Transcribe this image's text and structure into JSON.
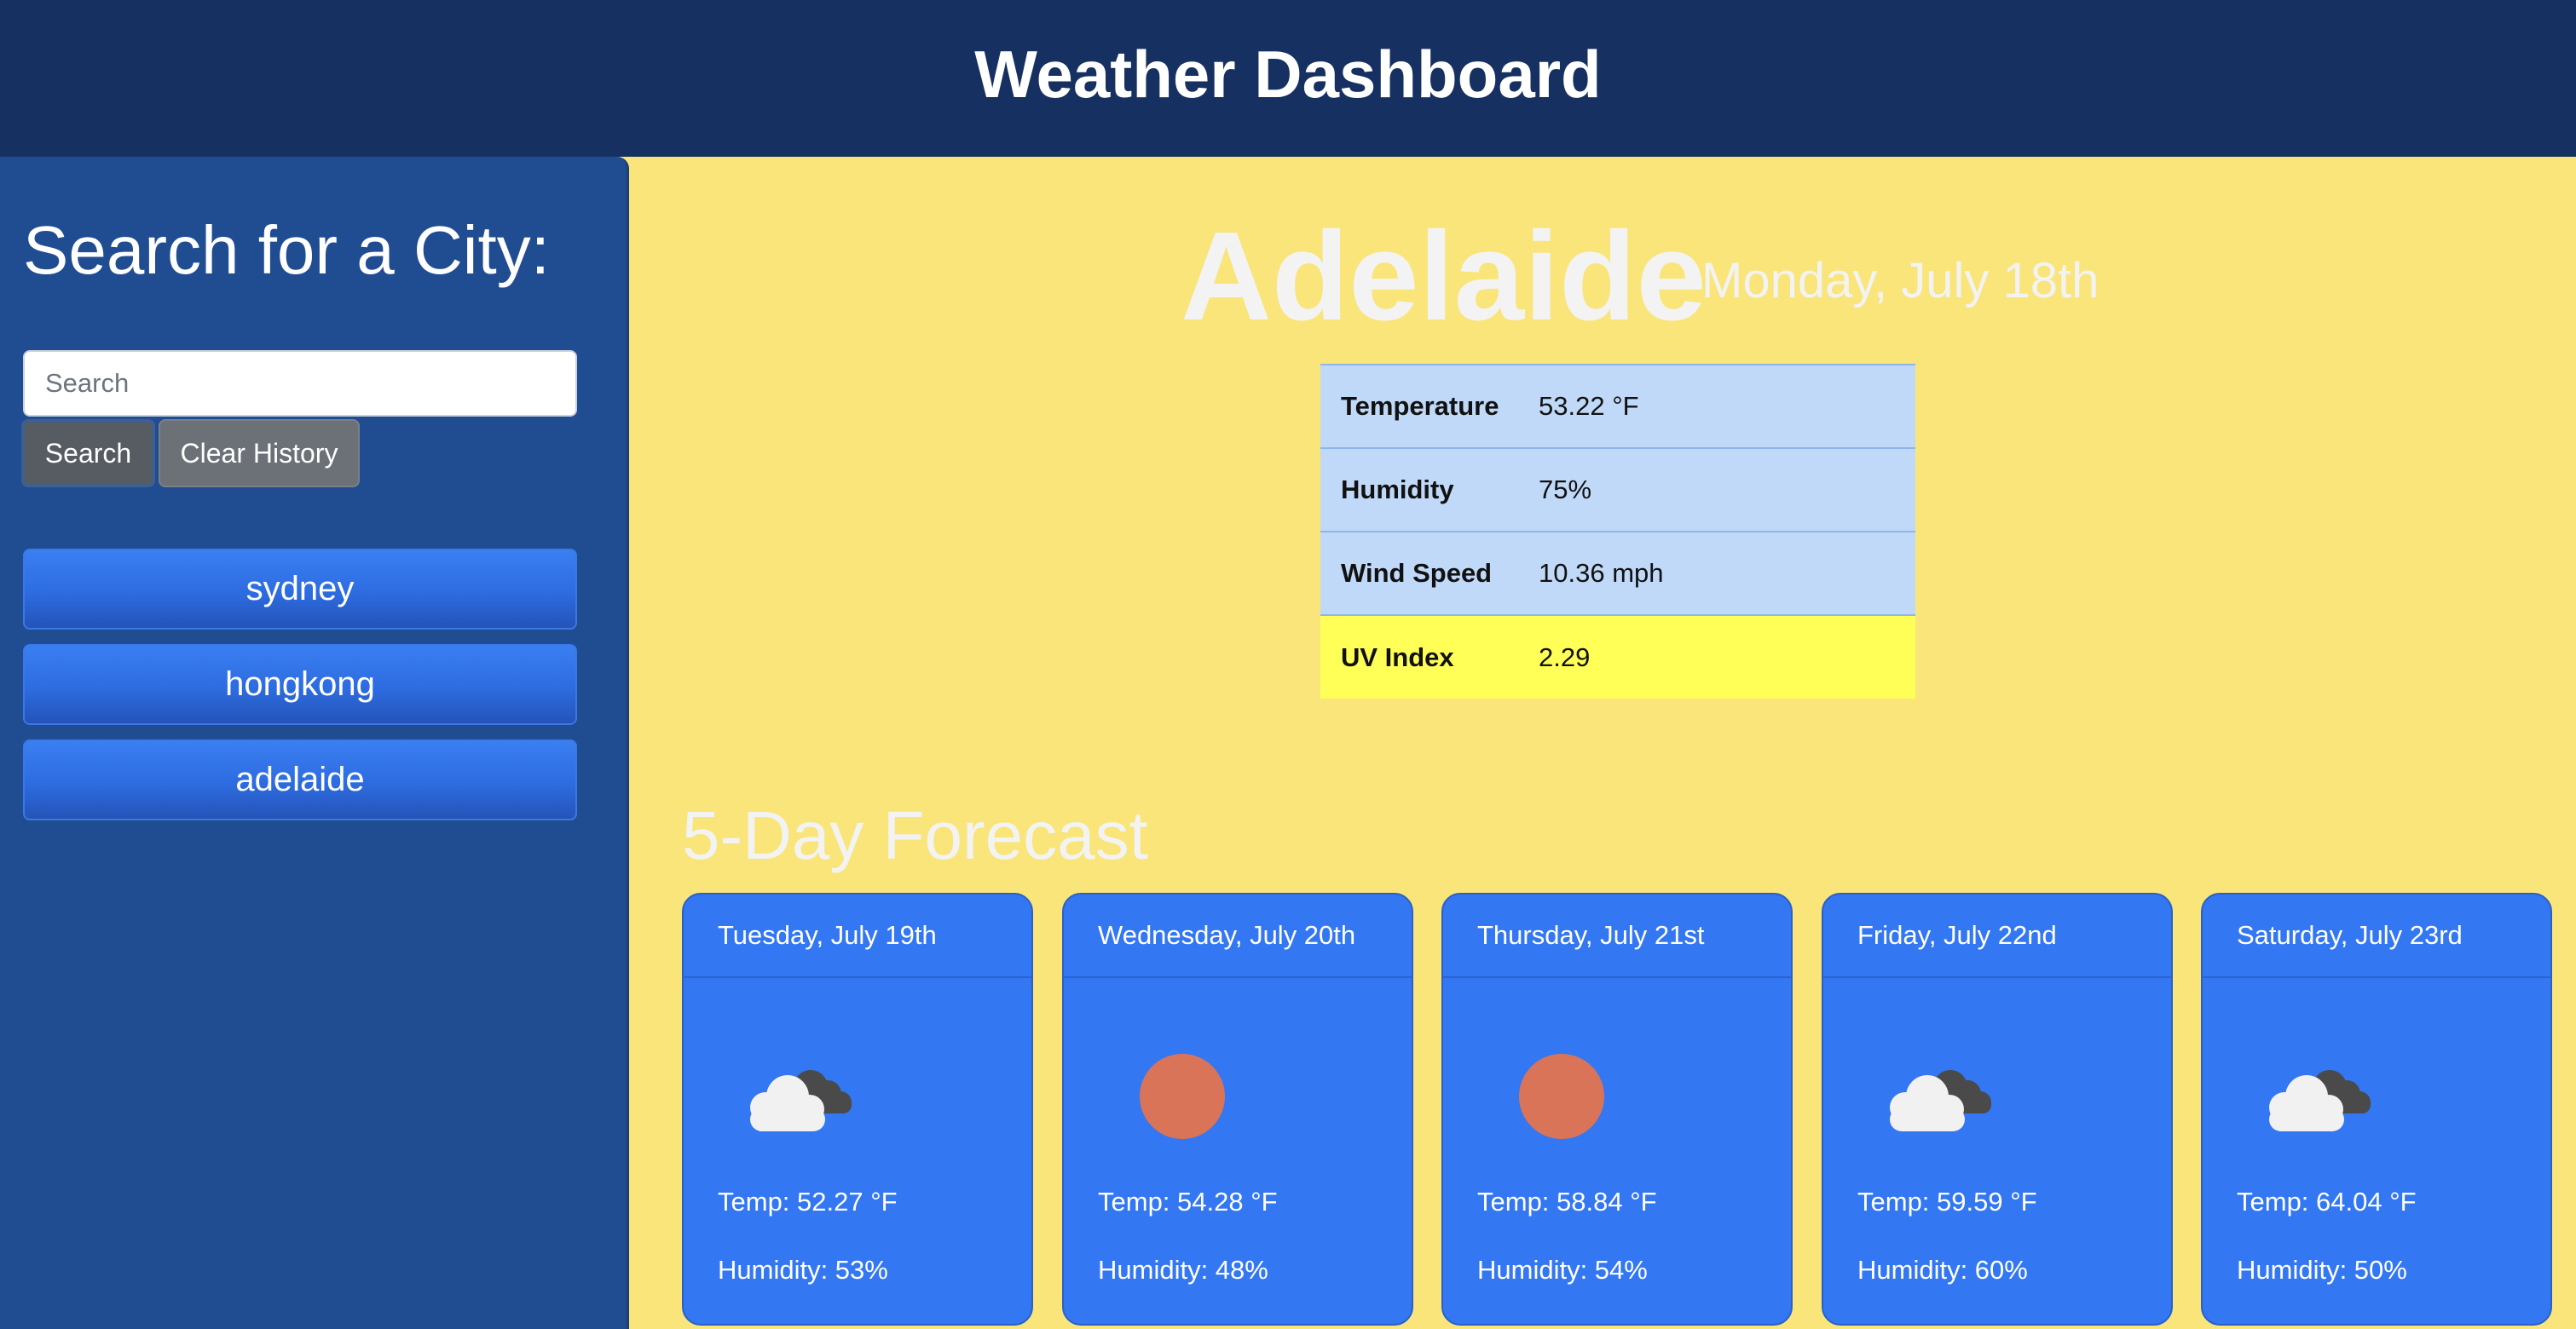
{
  "header": {
    "title": "Weather Dashboard"
  },
  "sidebar": {
    "title": "Search for a City:",
    "search_placeholder": "Search",
    "search_value": "",
    "search_button": "Search",
    "clear_button": "Clear History",
    "history": [
      "sydney",
      "hongkong",
      "adelaide"
    ]
  },
  "current": {
    "city": "Adelaide",
    "date": "Monday, July 18th",
    "stats": [
      {
        "label": "Temperature",
        "value": "53.22 °F"
      },
      {
        "label": "Humidity",
        "value": "75%"
      },
      {
        "label": "Wind Speed",
        "value": "10.36 mph"
      },
      {
        "label": "UV Index",
        "value": "2.29"
      }
    ],
    "uv_color": "#ffff57"
  },
  "forecast": {
    "title": "5-Day Forecast",
    "days": [
      {
        "date": "Tuesday, July 19th",
        "icon": "cloudy-icon",
        "temp": "Temp: 52.27 °F",
        "humidity": "Humidity: 53%"
      },
      {
        "date": "Wednesday, July 20th",
        "icon": "sun-icon",
        "temp": "Temp: 54.28 °F",
        "humidity": "Humidity: 48%"
      },
      {
        "date": "Thursday, July 21st",
        "icon": "sun-icon",
        "temp": "Temp: 58.84 °F",
        "humidity": "Humidity: 54%"
      },
      {
        "date": "Friday, July 22nd",
        "icon": "cloudy-icon",
        "temp": "Temp: 59.59 °F",
        "humidity": "Humidity: 60%"
      },
      {
        "date": "Saturday, July 23rd",
        "icon": "cloudy-icon",
        "temp": "Temp: 64.04 °F",
        "humidity": "Humidity: 50%"
      }
    ]
  },
  "colors": {
    "header_bg": "#163161",
    "sidebar_bg": "#204d92",
    "page_bg": "#f9e57a",
    "card_bg": "#3377f2",
    "sun": "#da7459"
  }
}
